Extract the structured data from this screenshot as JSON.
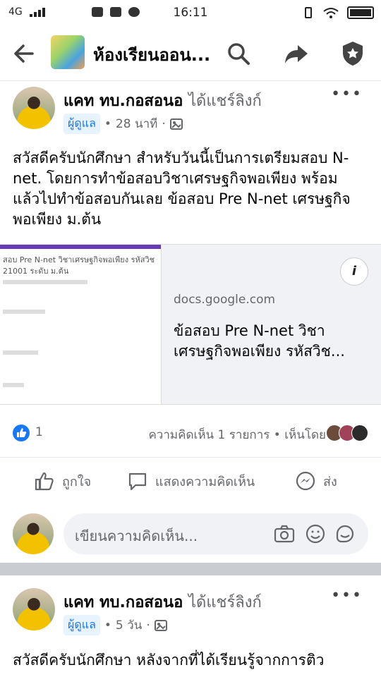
{
  "status_bar": {
    "network": "4G",
    "time": "16:11"
  },
  "header": {
    "group_name": "ห้องเรียนออน..."
  },
  "posts": [
    {
      "author": "แคท ทบ.กอสอนอ",
      "shared_text": "ได้แชร์ลิงก์",
      "role": "ผู้ดูแล",
      "time": "28 นาที",
      "text": "สวัสดีครับนักศึกษา สำหรับวันนี้เป็นการเตรียมสอบ N-net. โดยการทำข้อสอบวิชาเศรษฐกิจพอเพียง พร้อมแล้วไปทำข้อสอบกันเลย  ข้อสอบ Pre N-net เศรษฐกิจพอเพียง  ม.ต้น",
      "link": {
        "thumb_title": "สอบ Pre N-net วิชาเศรษฐกิจพอเพียง รหัสวิช",
        "thumb_code": "21001 ระดับ ม.ต้น",
        "domain": "docs.google.com",
        "title": "ข้อสอบ Pre N-net วิชา เศรษฐกิจพอเพียง รหัสวิช..."
      },
      "like_count": "1",
      "comment_summary": "ความคิดเห็น 1 รายการ • เห็นโดย",
      "actions": {
        "like": "ถูกใจ",
        "comment": "แสดงความคิดเห็น",
        "share": "ส่ง"
      },
      "comment_placeholder": "เขียนความคิดเห็น..."
    },
    {
      "author": "แคท ทบ.กอสอนอ",
      "shared_text": "ได้แชร์ลิงก์",
      "role": "ผู้ดูแล",
      "time": "5 วัน",
      "text": "สวัสดีครับนักศึกษา หลังจากที่ได้เรียนรู้จากการติว"
    }
  ],
  "colors": {
    "accent": "#1877f2",
    "text_secondary": "#65676b",
    "divider": "#c9ccd1"
  }
}
